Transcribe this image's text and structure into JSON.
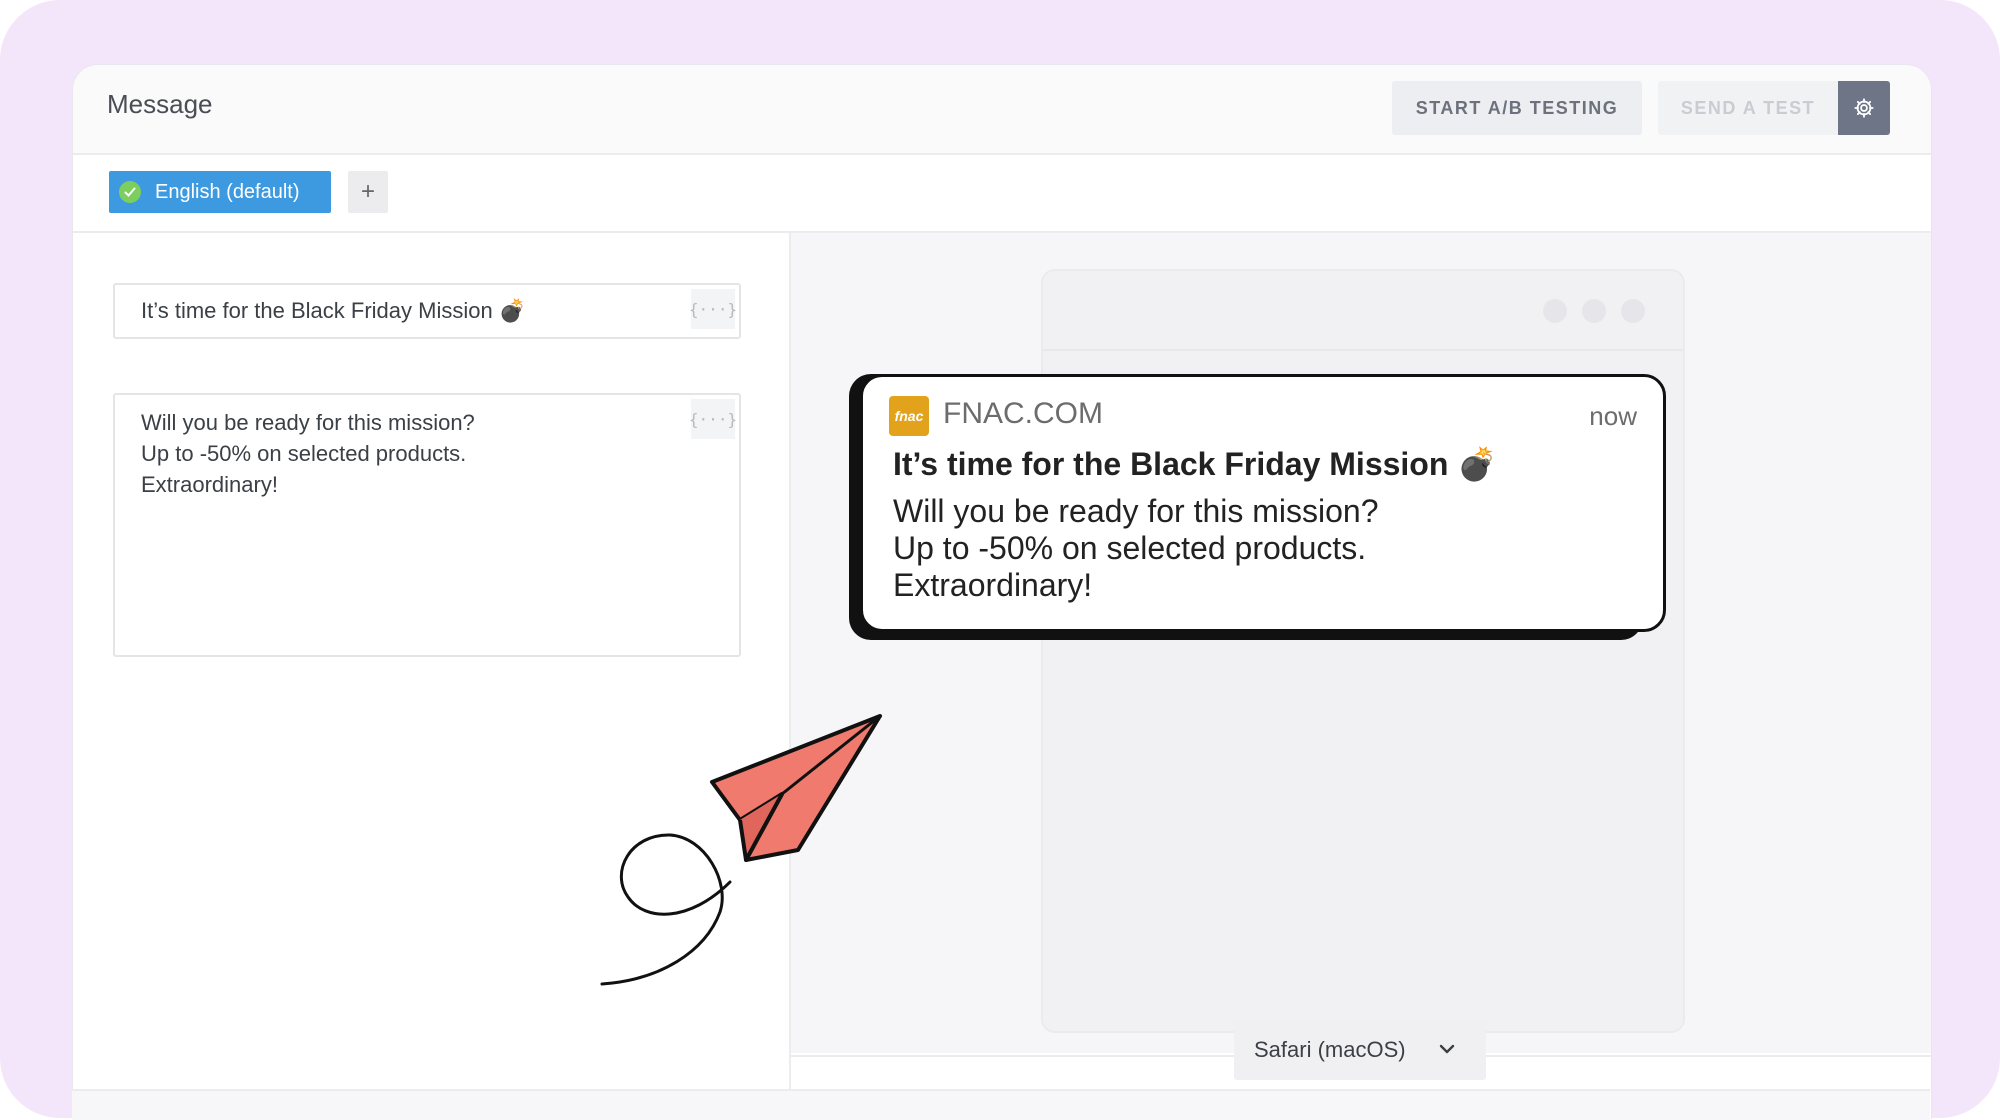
{
  "header": {
    "title": "Message",
    "ab_testing_label": "START A/B TESTING",
    "send_test_label": "SEND A TEST",
    "settings_icon": "gear-icon"
  },
  "languages": {
    "active_tab": "English (default)",
    "add_label": "+"
  },
  "editor": {
    "title_value": "It’s time for the Black Friday Mission 💣",
    "body_value": "Will you be ready for this mission?\nUp to -50% on selected products.\nExtraordinary!",
    "variable_button": "{···}"
  },
  "preview": {
    "app_icon_text": "fnac",
    "app_name": "FNAC.COM",
    "time": "now",
    "title": "It’s time for the Black Friday Mission 💣",
    "body": "Will you be ready for this mission?\nUp to -50% on selected products.\nExtraordinary!"
  },
  "browser_select": {
    "value": "Safari (macOS)"
  },
  "colors": {
    "background": "#f3e6fb",
    "lang_tab": "#3d9ae0",
    "app_icon": "#e2a21c",
    "plane": "#f07a6e"
  }
}
